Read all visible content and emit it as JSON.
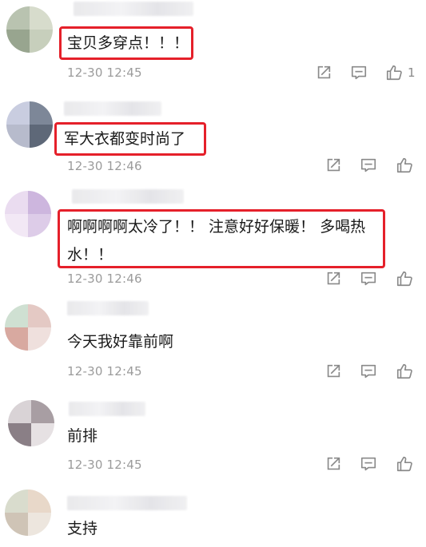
{
  "comments": [
    {
      "content_lines": [
        "宝贝多穿点！！！"
      ],
      "time": "12-30 12:45",
      "likes": "1"
    },
    {
      "content_lines": [
        "军大衣都变时尚了"
      ],
      "time": "12-30 12:46",
      "likes": ""
    },
    {
      "content_lines": [
        "啊啊啊啊太冷了！！ 注意好好保暖！ 多喝热",
        "水！！"
      ],
      "time": "12-30 12:46",
      "likes": ""
    },
    {
      "content_lines": [
        "今天我好靠前啊"
      ],
      "time": "12-30 12:45",
      "likes": ""
    },
    {
      "content_lines": [
        "前排"
      ],
      "time": "12-30 12:45",
      "likes": ""
    },
    {
      "content_lines": [
        "支持"
      ],
      "time": "",
      "likes": ""
    }
  ],
  "icons": {
    "share": "share-icon",
    "reply": "comment-icon",
    "like": "thumbs-up-icon"
  },
  "colors": {
    "highlight": "#e5202a",
    "text": "#1a1a1a",
    "meta": "#9b9b9b"
  }
}
